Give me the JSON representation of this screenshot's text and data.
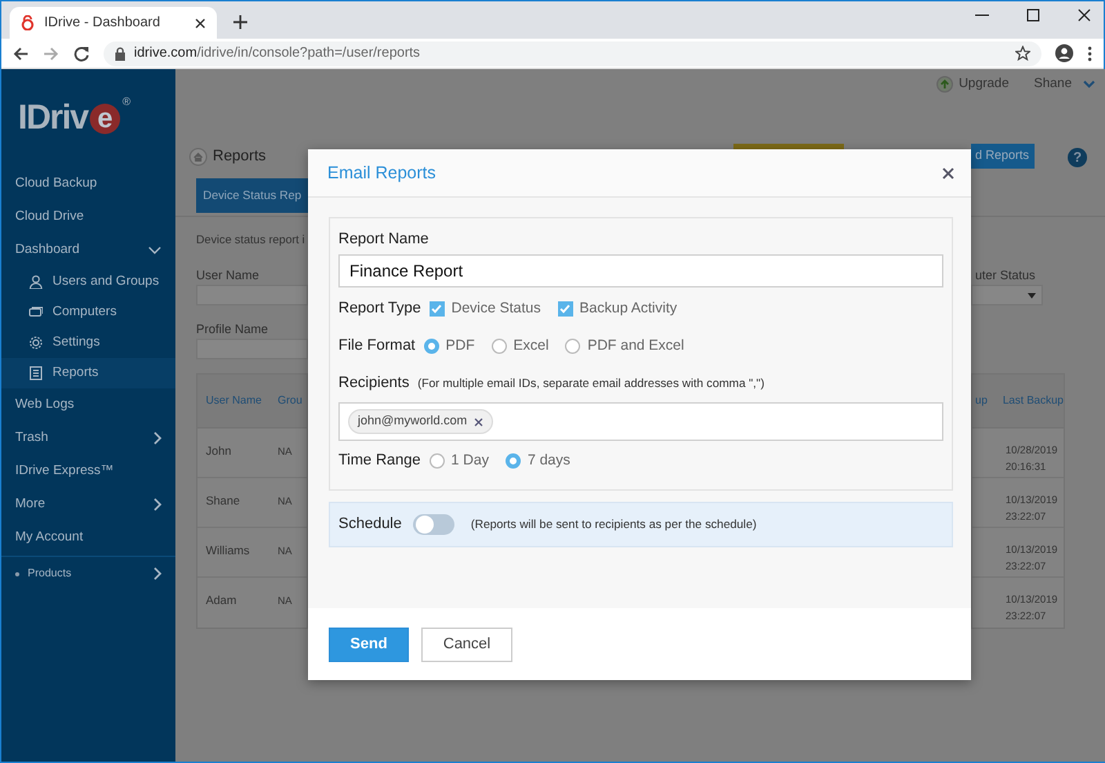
{
  "browser": {
    "tab_title": "IDrive - Dashboard",
    "url_host": "idrive.com",
    "url_path": "/idrive/in/console?path=/user/reports"
  },
  "header": {
    "upgrade": "Upgrade",
    "user": "Shane"
  },
  "sidebar": {
    "logo": {
      "text": "IDriv",
      "accent": "e",
      "mark": "®"
    },
    "items": [
      {
        "label": "Cloud Backup",
        "kind": "link"
      },
      {
        "label": "Cloud Drive",
        "kind": "link"
      },
      {
        "label": "Dashboard",
        "kind": "group",
        "expanded": true,
        "children": [
          {
            "label": "Users and Groups",
            "selected": false
          },
          {
            "label": "Computers",
            "selected": false
          },
          {
            "label": "Settings",
            "selected": false
          },
          {
            "label": "Reports",
            "selected": true
          }
        ]
      },
      {
        "label": "Web Logs",
        "kind": "link"
      },
      {
        "label": "Trash",
        "kind": "submenu"
      },
      {
        "label": "IDrive Express™",
        "kind": "link"
      },
      {
        "label": "More",
        "kind": "submenu"
      },
      {
        "label": "My Account",
        "kind": "link"
      }
    ],
    "footer": {
      "label": "Products",
      "kind": "submenu"
    }
  },
  "page": {
    "title": "Reports",
    "action_button": "d Reports",
    "help": "?",
    "tabs": [
      {
        "label": "Device Status Rep",
        "selected": true
      }
    ],
    "description": "Device status report i",
    "filters": [
      {
        "label": "User Name"
      },
      {
        "label": "Profile Name"
      }
    ],
    "filter_right": {
      "label": "uter Status"
    },
    "table": {
      "columns": [
        "User Name",
        "Grou",
        "up",
        "Last Backup"
      ],
      "rows": [
        {
          "user": "John",
          "group": "NA",
          "date": "10/28/2019",
          "time": "20:16:31"
        },
        {
          "user": "Shane",
          "group": "NA",
          "date": "10/13/2019",
          "time": "23:22:07"
        },
        {
          "user": "Williams",
          "group": "NA",
          "date": "10/13/2019",
          "time": "23:22:07"
        },
        {
          "user": "Adam",
          "group": "NA",
          "date": "10/13/2019",
          "time": "23:22:07"
        }
      ]
    }
  },
  "modal": {
    "title": "Email Reports",
    "report_name": {
      "label": "Report Name",
      "value": "Finance Report"
    },
    "report_type": {
      "label": "Report Type",
      "options": [
        {
          "label": "Device Status",
          "checked": true
        },
        {
          "label": "Backup Activity",
          "checked": true
        }
      ]
    },
    "file_format": {
      "label": "File Format",
      "options": [
        {
          "label": "PDF",
          "selected": true
        },
        {
          "label": "Excel",
          "selected": false
        },
        {
          "label": "PDF and Excel",
          "selected": false
        }
      ]
    },
    "recipients": {
      "label": "Recipients",
      "hint": "(For multiple email IDs, separate email addresses with comma \",\")",
      "chips": [
        "john@myworld.com"
      ]
    },
    "time_range": {
      "label": "Time Range",
      "options": [
        {
          "label": "1 Day",
          "selected": false
        },
        {
          "label": "7 days",
          "selected": true
        }
      ]
    },
    "schedule": {
      "label": "Schedule",
      "on": false,
      "note": "(Reports will be sent to recipients as per the schedule)"
    },
    "buttons": [
      {
        "label": "Send",
        "kind": "primary"
      },
      {
        "label": "Cancel",
        "kind": "secondary"
      }
    ]
  }
}
